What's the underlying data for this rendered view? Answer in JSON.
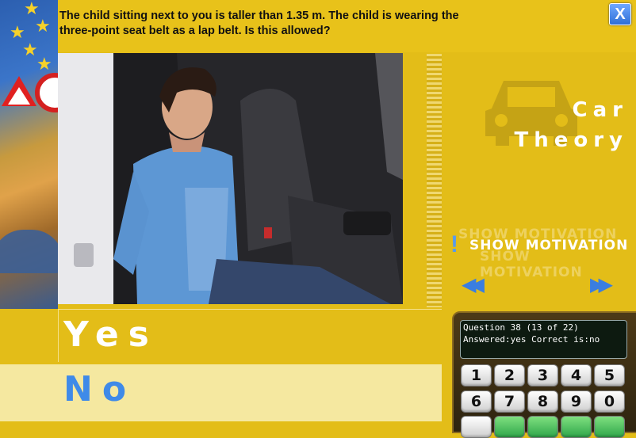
{
  "question": {
    "text": "The child sitting next to you is taller than 1.35 m. The child is wearing the three-point seat belt as a lap belt. Is this allowed?"
  },
  "close_label": "X",
  "brand": {
    "line1": "Car",
    "line2": "Theory"
  },
  "motivation": {
    "label": "SHOW MOTIVATION",
    "icon": "!"
  },
  "navigation": {
    "prev_label": "◀◀",
    "next_label": "▶▶"
  },
  "answers": [
    {
      "label": "Yes"
    },
    {
      "label": "No"
    }
  ],
  "status": {
    "line1": "Question 38 (13 of 22)",
    "line2": "Answered:yes Correct is:no"
  },
  "keypad": {
    "row1": [
      "1",
      "2",
      "3",
      "4",
      "5"
    ],
    "row2": [
      "6",
      "7",
      "8",
      "9",
      "0"
    ]
  },
  "colors": {
    "background": "#e3bd18",
    "accent_blue": "#3f8ae8",
    "selected_answer_bg": "#f5e8a0"
  }
}
